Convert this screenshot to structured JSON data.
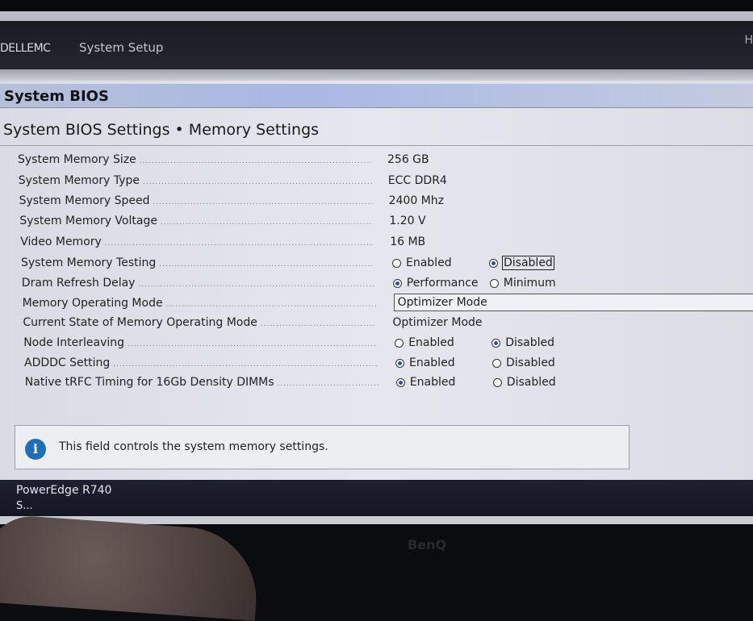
{
  "header": {
    "logo": "DELL",
    "logo_suffix": "EMC",
    "app_title": "System Setup",
    "help_partial": "H"
  },
  "title": "System BIOS",
  "breadcrumb": "System BIOS Settings • Memory Settings",
  "rows": [
    {
      "label": "System Memory Size",
      "value": "256 GB"
    },
    {
      "label": "System Memory Type",
      "value": "ECC DDR4"
    },
    {
      "label": "System Memory Speed",
      "value": "2400 Mhz"
    },
    {
      "label": "System Memory Voltage",
      "value": "1.20 V"
    },
    {
      "label": "Video Memory",
      "value": "16 MB"
    },
    {
      "label": "System Memory Testing",
      "options": [
        {
          "label": "Enabled",
          "selected": false
        },
        {
          "label": "Disabled",
          "selected": true
        }
      ]
    },
    {
      "label": "Dram Refresh Delay",
      "options": [
        {
          "label": "Performance",
          "selected": true
        },
        {
          "label": "Minimum",
          "selected": false
        }
      ]
    },
    {
      "label": "Memory Operating Mode",
      "select": "Optimizer Mode"
    },
    {
      "label": "Current State of Memory Operating Mode",
      "value": "Optimizer Mode"
    },
    {
      "label": "Node Interleaving",
      "options": [
        {
          "label": "Enabled",
          "selected": false
        },
        {
          "label": "Disabled",
          "selected": true
        }
      ]
    },
    {
      "label": "ADDDC Setting",
      "options": [
        {
          "label": "Enabled",
          "selected": true
        },
        {
          "label": "Disabled",
          "selected": false
        }
      ]
    },
    {
      "label": "Native tRFC Timing for 16Gb Density DIMMs",
      "options": [
        {
          "label": "Enabled",
          "selected": true
        },
        {
          "label": "Disabled",
          "selected": false
        }
      ]
    }
  ],
  "info": {
    "icon": "info-icon",
    "glyph": "i",
    "text": "This field controls the system memory settings."
  },
  "footer": {
    "model": "PowerEdge R740",
    "sub": "S..."
  },
  "monitor_brand": "BenQ"
}
